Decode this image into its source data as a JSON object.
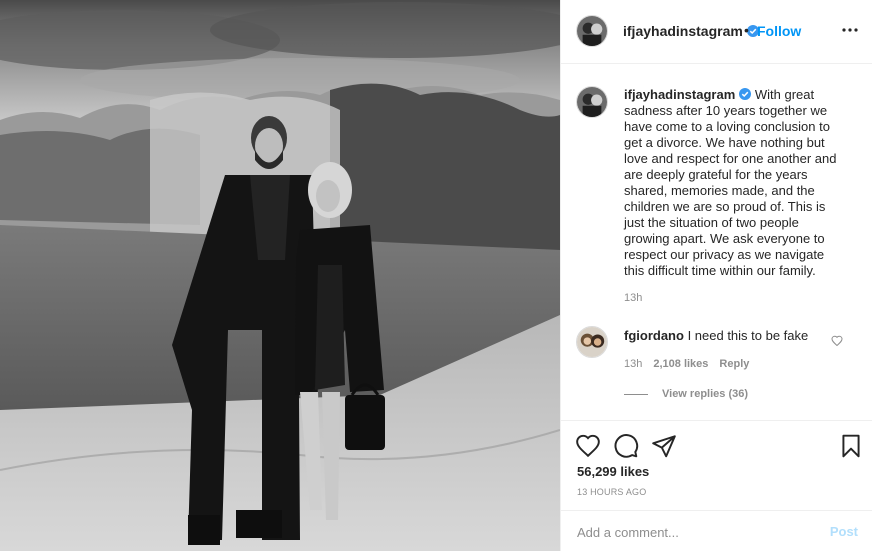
{
  "post": {
    "author": "ifjayhadinstagram",
    "follow_label": "Follow",
    "separator": "•",
    "more_icon": "more-horizontal-icon"
  },
  "caption": {
    "author": "ifjayhadinstagram",
    "text": "With great sadness after 10 years together we have come to a loving conclusion to get a divorce. We have nothing but love and respect for one another and are deeply grateful for the years shared, memories made, and the children we are so proud of. This is just the situation of two people growing apart. We ask everyone to respect our privacy as we navigate this difficult time within our family.",
    "time": "13h"
  },
  "comment": {
    "author": "fgiordano",
    "text": "I need this to be fake",
    "time": "13h",
    "likes": "2,108 likes",
    "reply_label": "Reply",
    "view_replies": "View replies (36)"
  },
  "actions": {
    "like_icon": "heart-icon",
    "comment_icon": "comment-icon",
    "share_icon": "paper-plane-icon",
    "save_icon": "bookmark-icon"
  },
  "stats": {
    "likes": "56,299 likes",
    "timestamp": "13 HOURS AGO"
  },
  "add_comment": {
    "placeholder": "Add a comment...",
    "post_label": "Post"
  },
  "colors": {
    "link_blue": "#0095f6",
    "post_disabled": "#b2dffc",
    "verified_blue": "#3897f0",
    "secondary_text": "#8e8e8e"
  }
}
